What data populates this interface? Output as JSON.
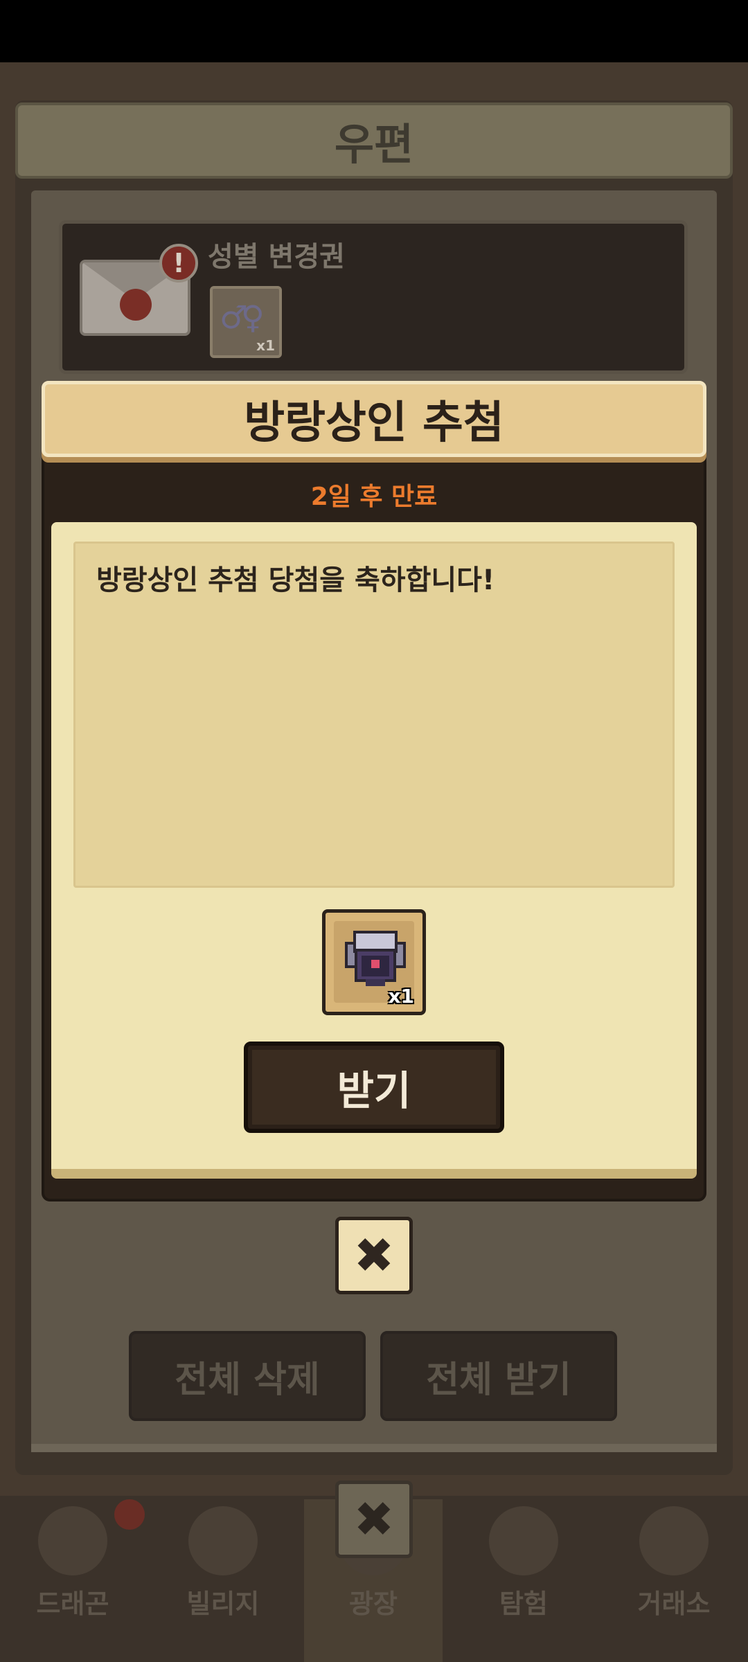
{
  "mailbox": {
    "title": "우편",
    "items": [
      {
        "title": "성별 변경권",
        "attachment_qty": "x1",
        "alert_icon": "!"
      }
    ],
    "delete_all_label": "전체 삭제",
    "receive_all_label": "전체 받기",
    "close_icon": "✖"
  },
  "dialog": {
    "title": "방랑상인 추첨",
    "expire_text": "2일 후 만료",
    "message": "방랑상인 추첨 당첨을 축하합니다!",
    "reward_qty": "x1",
    "receive_label": "받기",
    "close_icon": "✖"
  },
  "tabs": [
    {
      "label": "드래곤"
    },
    {
      "label": "빌리지"
    },
    {
      "label": "광장"
    },
    {
      "label": "탐험"
    },
    {
      "label": "거래소"
    }
  ],
  "colors": {
    "dialog_header": "#e6ca92",
    "expire_text": "#ec7b2d",
    "dialog_body": "#efe4b3",
    "receive_button": "#3a2c20"
  }
}
